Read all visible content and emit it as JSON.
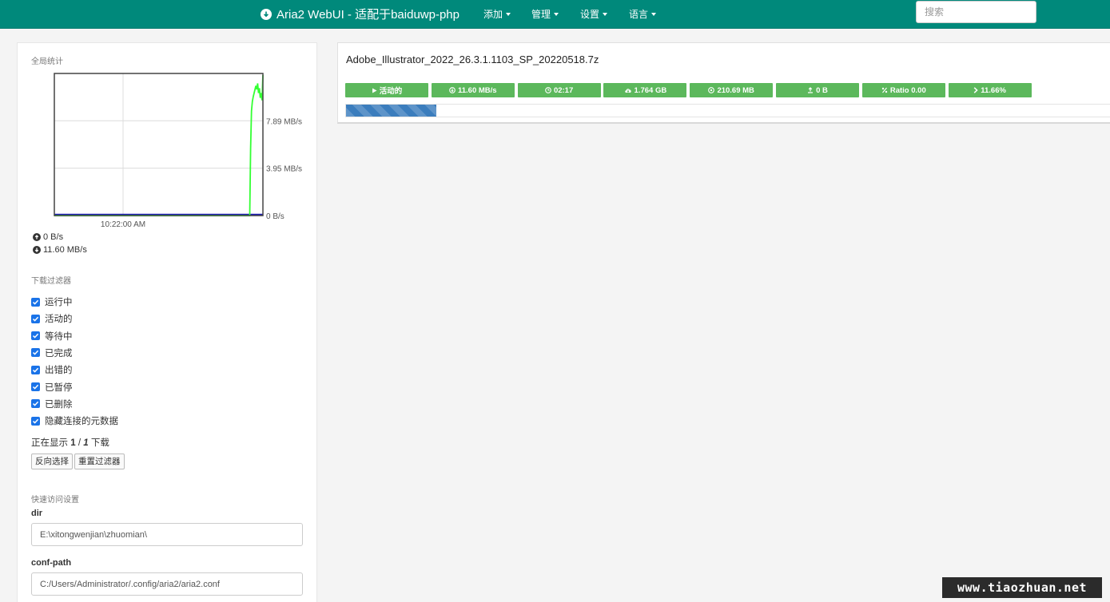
{
  "navbar": {
    "brand": "Aria2 WebUI - 适配于baiduwp-php",
    "brand_icon": "download-circle-icon",
    "menus": [
      "添加",
      "管理",
      "设置",
      "语言"
    ],
    "search_placeholder": "搜索"
  },
  "sidebar": {
    "global_stats_title": "全局统计",
    "chart_data": {
      "type": "line",
      "title": "",
      "xlabel": "",
      "ylabel": "",
      "x_tick_labels": [
        "10:22:00 AM"
      ],
      "y_tick_labels": [
        "0 B/s",
        "3.95 MB/s",
        "7.89 MB/s"
      ],
      "ylim": [
        0,
        11.83
      ],
      "y_unit": "MB/s",
      "grid": true,
      "series": [
        {
          "color": "#33ff33",
          "values": [
            0,
            0,
            0,
            0,
            0,
            0,
            0,
            0,
            0,
            0,
            0,
            0,
            0,
            0,
            0,
            0,
            0,
            0,
            0,
            0,
            0,
            0,
            0,
            0,
            0,
            0,
            0,
            0,
            0,
            0,
            0,
            0,
            0,
            0,
            0,
            0,
            0,
            0,
            0,
            0,
            0,
            0,
            0,
            0,
            0,
            0,
            0,
            0,
            0,
            0,
            0,
            0,
            0,
            0,
            0,
            0,
            0,
            0,
            0,
            0,
            0,
            0,
            0,
            0,
            0,
            0,
            0,
            0,
            0,
            0,
            0,
            0,
            0,
            0,
            0,
            0,
            0,
            0,
            0,
            0,
            0,
            0,
            0,
            0,
            0,
            0,
            0,
            0,
            0,
            0,
            0,
            0,
            0,
            0,
            0,
            0,
            0,
            0,
            0,
            0,
            0,
            0,
            0,
            0,
            0,
            0,
            0,
            0,
            0,
            0,
            0,
            0,
            0,
            0,
            0,
            0,
            0,
            0,
            0,
            0,
            0,
            0,
            0,
            0,
            0,
            0,
            0,
            0,
            0,
            0,
            0,
            0,
            0,
            0,
            0,
            0,
            0,
            0,
            0,
            0,
            0,
            0,
            0,
            0,
            0,
            0,
            0,
            0,
            0,
            0,
            0,
            0,
            0,
            0,
            0,
            0,
            0,
            0,
            0,
            0,
            0,
            0,
            0,
            0,
            0,
            0,
            0,
            0,
            0,
            0,
            0,
            0,
            0,
            0,
            0,
            0,
            0,
            0,
            0,
            0,
            0,
            0,
            0,
            0,
            0,
            0,
            0,
            0,
            0,
            0,
            0,
            0,
            0,
            0,
            0,
            0,
            0,
            0,
            0,
            0,
            0,
            0,
            0,
            0,
            0,
            0,
            0,
            0,
            0,
            0,
            0,
            0,
            0,
            0,
            0,
            0,
            0,
            0,
            0,
            0,
            0,
            0,
            0,
            5.6,
            8.7,
            9.5,
            9.9,
            10.2,
            10.5,
            10.8,
            10.5,
            11.0,
            10.2,
            10.6,
            9.8,
            10.2,
            9.6,
            11.7
          ]
        },
        {
          "color": "#1a1ab3",
          "values": [
            0
          ]
        }
      ]
    },
    "upload_speed": "0 B/s",
    "upload_icon": "upload-circle-icon",
    "download_speed": "11.60 MB/s",
    "download_icon": "download-circle-icon",
    "filter_title": "下载过滤器",
    "filters": [
      {
        "label": "运行中",
        "checked": true
      },
      {
        "label": "活动的",
        "checked": true
      },
      {
        "label": "等待中",
        "checked": true
      },
      {
        "label": "已完成",
        "checked": true
      },
      {
        "label": "出错的",
        "checked": true
      },
      {
        "label": "已暂停",
        "checked": true
      },
      {
        "label": "已删除",
        "checked": true
      },
      {
        "label": "隐藏连接的元数据",
        "checked": true
      }
    ],
    "showing_prefix": "正在显示",
    "showing_current": "1",
    "showing_sep": "/",
    "showing_total": "1",
    "showing_suffix": "下载",
    "invert_button": "反向选择",
    "reset_button": "重置过滤器",
    "quick_settings_title": "快速访问设置",
    "dir_label": "dir",
    "dir_value": "E:\\xitongwenjian\\zhuomian\\",
    "conf_label": "conf-path",
    "conf_value": "C:/Users/Administrator/.config/aria2/aria2.conf"
  },
  "download": {
    "name": "Adobe_Illustrator_2022_26.3.1.1103_SP_20220518.7z",
    "stats": [
      {
        "icon": "play-icon",
        "text": "活动的"
      },
      {
        "icon": "download-speed-icon",
        "text": "11.60 MB/s"
      },
      {
        "icon": "clock-icon",
        "text": "02:17"
      },
      {
        "icon": "cloud-download-icon",
        "text": "1.764 GB"
      },
      {
        "icon": "downloaded-icon",
        "text": "210.69 MB"
      },
      {
        "icon": "upload-icon",
        "text": "0 B"
      },
      {
        "icon": "ratio-icon",
        "text": "Ratio 0.00"
      },
      {
        "icon": "chevron-right-icon",
        "text": "11.66%"
      }
    ],
    "progress_percent": 11.66,
    "colors": {
      "stat_bg": "#5cb85c",
      "progress": "#3b7dbd"
    }
  },
  "watermark": "www.tiaozhuan.net",
  "colors": {
    "navbar": "#00897b"
  }
}
